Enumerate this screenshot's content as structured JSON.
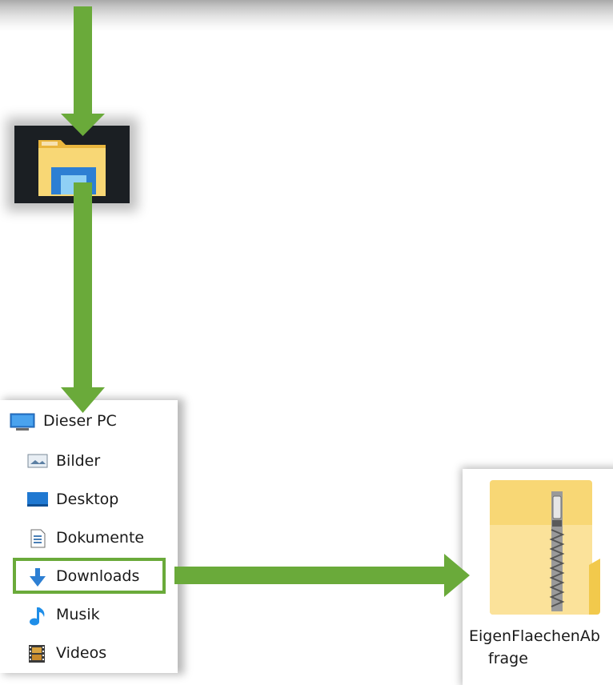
{
  "nav": {
    "root": "Dieser PC",
    "items": [
      {
        "label": "Bilder",
        "icon": "pictures-icon"
      },
      {
        "label": "Desktop",
        "icon": "desktop-icon"
      },
      {
        "label": "Dokumente",
        "icon": "documents-icon"
      },
      {
        "label": "Downloads",
        "icon": "downloads-icon"
      },
      {
        "label": "Musik",
        "icon": "music-icon"
      },
      {
        "label": "Videos",
        "icon": "videos-icon"
      }
    ]
  },
  "file": {
    "name_line1": "EigenFlaechenAb",
    "name_line2": "frage",
    "icon": "zip-folder-icon"
  },
  "colors": {
    "arrow": "#6aaa3a",
    "folder": "#f8d775",
    "accent_blue": "#2d7fd3"
  }
}
